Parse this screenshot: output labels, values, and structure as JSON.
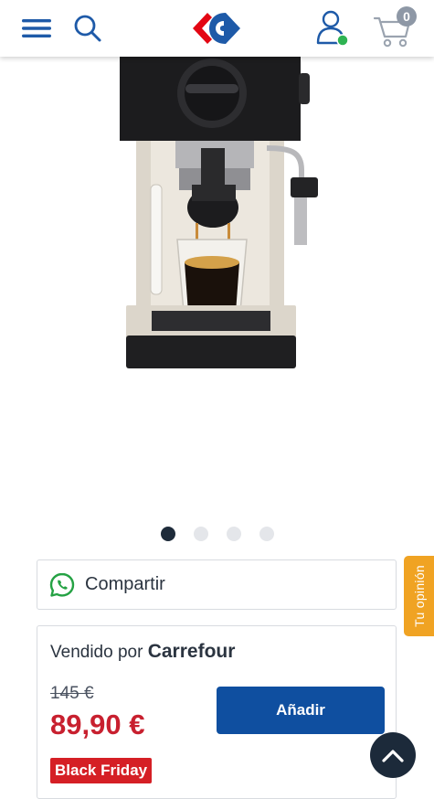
{
  "header": {
    "menu_icon": "hamburger-menu-icon",
    "search_icon": "search-icon",
    "logo": "carrefour-logo",
    "account_icon": "user-account-icon",
    "cart_icon": "shopping-cart-icon",
    "cart_count": "0",
    "colors": {
      "brand_blue": "#0f4fa0",
      "brand_red": "#e30613",
      "online_green": "#2eb352"
    }
  },
  "product": {
    "image": "espresso-machine-photo",
    "gallery": {
      "total": 4,
      "active_index": 0
    }
  },
  "share": {
    "icon": "whatsapp-icon",
    "label": "Compartir"
  },
  "feedback_tab": {
    "label": "Tu opinión",
    "color": "#f0a323"
  },
  "seller": {
    "sold_by_prefix": "Vendido por",
    "seller_name": "Carrefour",
    "old_price": "145 €",
    "price": "89,90 €",
    "add_button": "Añadir",
    "promo_badge": "Black Friday",
    "colors": {
      "price": "#c8202f",
      "promo": "#d51f25"
    }
  },
  "scroll_top": {
    "icon": "chevron-up-icon"
  }
}
